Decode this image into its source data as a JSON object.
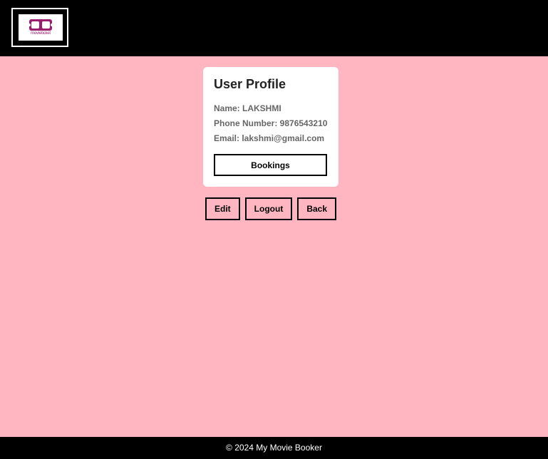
{
  "header": {
    "logo": {
      "text": "movieticket",
      "icon": "movie-ticket-logo-icon"
    }
  },
  "profile": {
    "title": "User Profile",
    "name": "Name: LAKSHMI",
    "phone": "Phone Number: 9876543210",
    "email": "Email: lakshmi@gmail.com",
    "bookings_label": "Bookings"
  },
  "actions": {
    "edit_label": "Edit",
    "logout_label": "Logout",
    "back_label": "Back"
  },
  "footer": {
    "text": "© 2024 My Movie Booker"
  },
  "colors": {
    "header_bg": "#000000",
    "page_bg": "#ffb6c1",
    "card_bg": "#ffffff",
    "logo_accent": "#9b1e6e"
  }
}
